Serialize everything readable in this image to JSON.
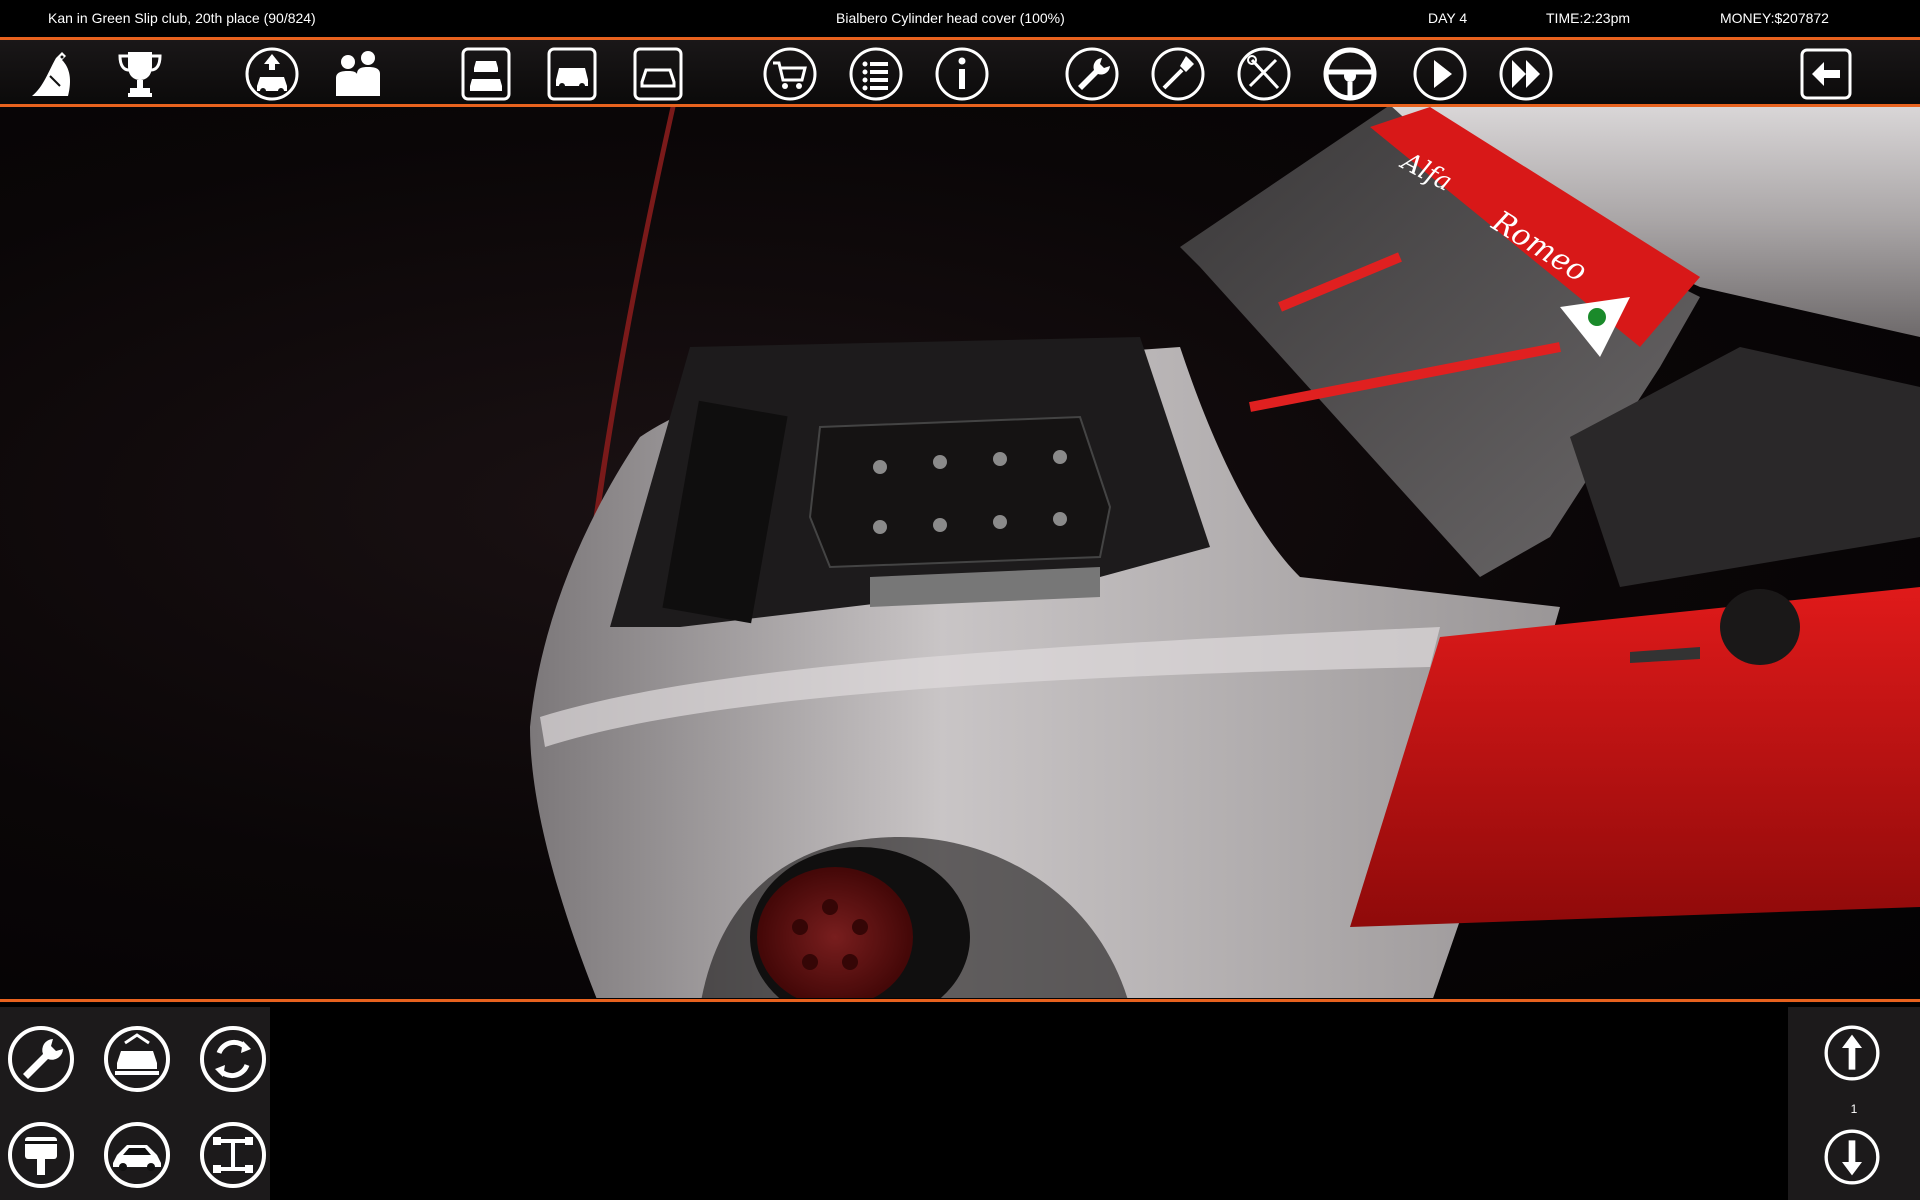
{
  "status_bar": {
    "club_status": "Kan in Green Slip club, 20th place (90/824)",
    "selected_part": "Bialbero Cylinder head cover (100%)",
    "day": "DAY 4",
    "time": "TIME:2:23pm",
    "money": "MONEY:$207872"
  },
  "toolbar_icons": [
    "club-logo",
    "trophy",
    "upgrade-car",
    "customers",
    "car-list",
    "car-garage",
    "car-view",
    "shop-cart",
    "task-list",
    "info",
    "wrench",
    "screwdriver",
    "tools-wrench",
    "steering-wheel",
    "play",
    "fast-forward",
    "back-exit"
  ],
  "windshield_banner": {
    "brand_line1": "Alfa",
    "brand_line2": "Romeo"
  },
  "bottom_left_icons": [
    "repair-wrench",
    "car-lift",
    "rotate-view",
    "engine-piston",
    "car-body",
    "chassis-frame"
  ],
  "pager": {
    "page": "1"
  },
  "colors": {
    "accent": "#e8621e",
    "body_red": "#c81515",
    "body_silver": "#b5b1b2"
  }
}
